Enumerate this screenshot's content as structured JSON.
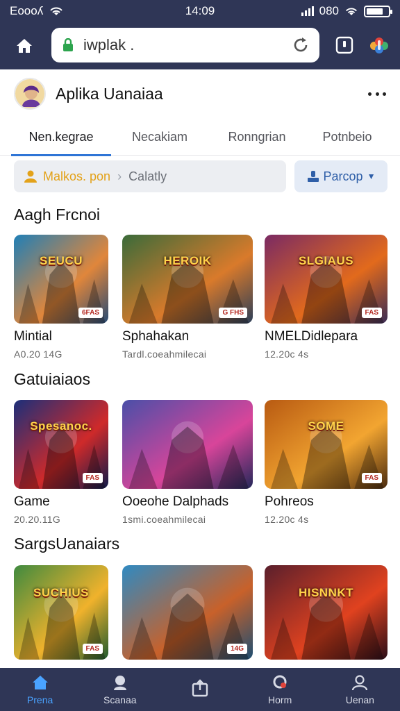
{
  "status_bar": {
    "carrier": "Eoooʎ",
    "time": "14:09",
    "battery_label": "080",
    "battery_level": 0.75
  },
  "browser": {
    "url": "iwplak .",
    "icons": [
      "home-icon",
      "lock-icon",
      "reload-icon",
      "tabs-icon",
      "mic-icon"
    ]
  },
  "app": {
    "title": "Aplika Uanaiaa"
  },
  "tabs": [
    {
      "label": "Nen.kegrae",
      "active": true
    },
    {
      "label": "Necakiam",
      "active": false
    },
    {
      "label": "Ronngrian",
      "active": false
    },
    {
      "label": "Potnbeio",
      "active": false
    }
  ],
  "filter": {
    "crumb_1": "Malkos. pon",
    "crumb_2": "Calatly",
    "dropdown_label": "Parcop"
  },
  "sections": [
    {
      "title": "Aagh Frcnoi",
      "cards": [
        {
          "title": "Mintial",
          "meta": "A0.20 14G",
          "badge": "SEUCU",
          "badge2": "6FAS",
          "palette": [
            "#1f7fb7",
            "#e0863b",
            "#274a74"
          ]
        },
        {
          "title": "Sphahakan",
          "meta": "Tardl.coeahmilecai",
          "badge": "HEROIK",
          "badge2": "G FHS",
          "palette": [
            "#3a6b3a",
            "#d97a2b",
            "#2b3e58"
          ]
        },
        {
          "title": "NMELDidlepara",
          "meta": "12.20c 4s",
          "badge": "SLGIAUS",
          "badge2": "FAS",
          "palette": [
            "#7a2a63",
            "#e26a1c",
            "#3a2c55"
          ]
        }
      ]
    },
    {
      "title": "Gatuiaiaos",
      "cards": [
        {
          "title": "Game",
          "meta": "20.20.11G",
          "badge": "Spesanoc.",
          "badge2": "FAS",
          "palette": [
            "#1b2f7a",
            "#cf2a2a",
            "#0f1a4a"
          ]
        },
        {
          "title": "Ooeohe Dalphads",
          "meta": "1smi.coeahmilecai",
          "badge": "",
          "badge2": "",
          "palette": [
            "#4a4fa8",
            "#d8459a",
            "#24285a"
          ]
        },
        {
          "title": "Pohreos",
          "meta": "12.20c 4s",
          "badge": "SOME",
          "badge2": "FAS",
          "palette": [
            "#b85a12",
            "#f2a531",
            "#4a2a0e"
          ]
        }
      ]
    },
    {
      "title": "SargsUanaiars",
      "cards": [
        {
          "title": "",
          "meta": "",
          "badge": "SUCHIUS",
          "badge2": "FAS",
          "palette": [
            "#3f8a3f",
            "#f0b22c",
            "#1f5a2e"
          ]
        },
        {
          "title": "",
          "meta": "",
          "badge": "",
          "badge2": "14G",
          "palette": [
            "#2f8ac2",
            "#c8612a",
            "#1d4e72"
          ]
        },
        {
          "title": "",
          "meta": "",
          "badge": "HISNNKT",
          "badge2": "",
          "palette": [
            "#5a1f2c",
            "#e0421f",
            "#2a0e18"
          ]
        }
      ]
    }
  ],
  "bottom_nav": [
    {
      "label": "Prena",
      "icon": "home-icon",
      "active": true
    },
    {
      "label": "Scanaa",
      "icon": "search-icon",
      "active": false
    },
    {
      "label": "",
      "icon": "share-icon",
      "active": false
    },
    {
      "label": "Horm",
      "icon": "notification-icon",
      "active": false
    },
    {
      "label": "Uenan",
      "icon": "profile-icon",
      "active": false
    }
  ]
}
